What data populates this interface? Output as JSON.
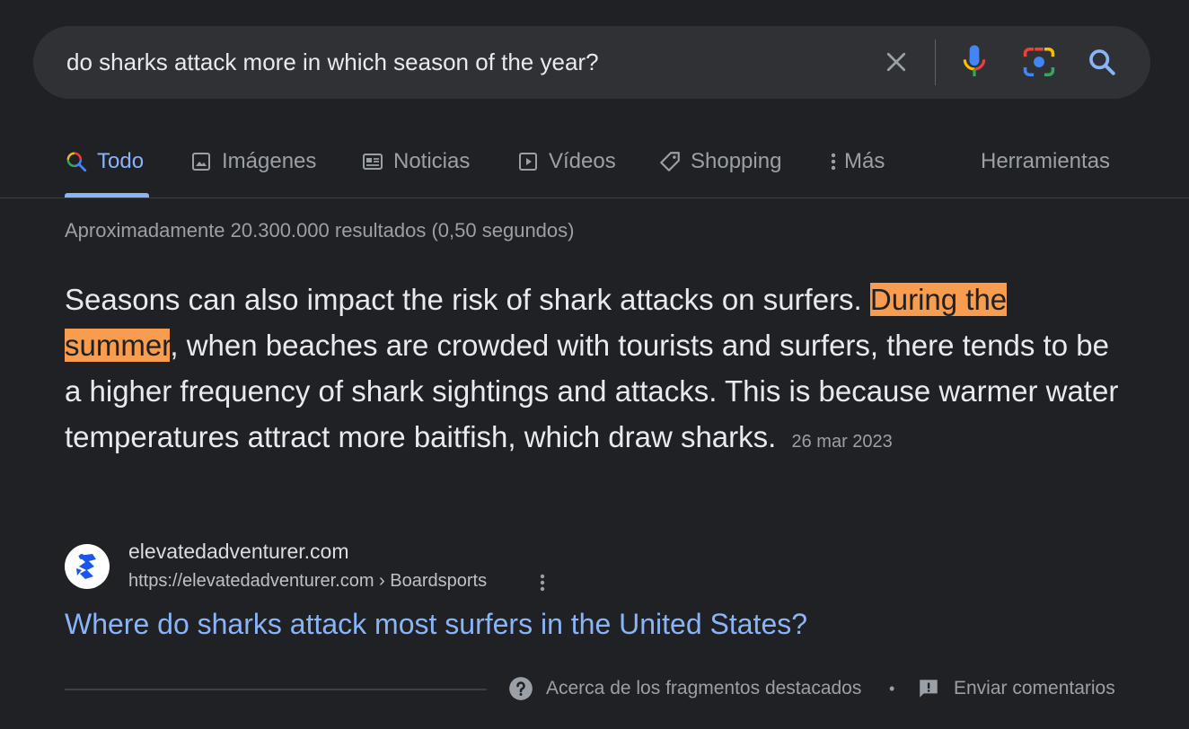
{
  "search": {
    "query": "do sharks attack more in which season of the year?",
    "icons": [
      "clear-icon",
      "microphone-icon",
      "camera-lens-icon",
      "search-icon"
    ]
  },
  "tabs": [
    {
      "label": "Todo",
      "icon": "search-icon",
      "active": true
    },
    {
      "label": "Imágenes",
      "icon": "image-icon"
    },
    {
      "label": "Noticias",
      "icon": "news-icon"
    },
    {
      "label": "Vídeos",
      "icon": "video-icon"
    },
    {
      "label": "Shopping",
      "icon": "tag-icon"
    },
    {
      "label": "Más",
      "icon": "more-vert-icon"
    },
    {
      "label": "Herramientas"
    }
  ],
  "result_stats": "Aproximadamente 20.300.000 resultados (0,50 segundos)",
  "snippet": {
    "before": "Seasons can also impact the risk of shark attacks on surfers. ",
    "highlight": "During the summer",
    "after": ", when beaches are crowded with tourists and surfers, there tends to be a higher frequency of shark sightings and attacks. This is because warmer water temperatures attract more baitfish, which draw sharks.",
    "date": "26 mar 2023"
  },
  "source": {
    "site_name": "elevatedadventurer.com",
    "url": "https://elevatedadventurer.com › Boardsports",
    "title": "Where do sharks attack most surfers in the United States?"
  },
  "footer": {
    "about": "Acerca de los fragmentos destacados",
    "separator": "•",
    "feedback": "Enviar comentarios"
  },
  "colors": {
    "background": "#202124",
    "search_bar": "#303134",
    "link": "#8ab4f8",
    "highlight": "#f89d4f",
    "muted": "#9aa0a6"
  }
}
